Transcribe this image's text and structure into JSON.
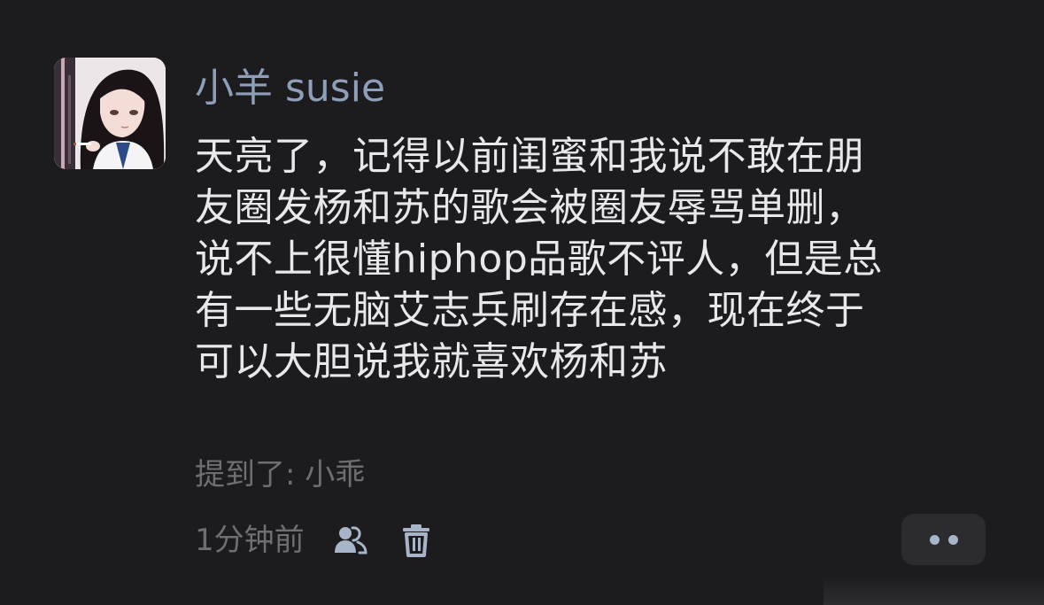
{
  "post": {
    "author_name": "小羊 susie",
    "content_lines": [
      "天亮了，记得以前闺蜜和我说不敢在朋",
      "友圈发杨和苏的歌会被圈友辱骂单删，",
      "说不上很懂hiphop品歌不评人，但是总",
      "有一些无脑艾志兵刷存在感，现在终于",
      "可以大胆说我就喜欢杨和苏"
    ],
    "mention_text": "提到了: 小乖",
    "timestamp": "1分钟前",
    "icons": {
      "visibility": "friends-icon",
      "delete": "trash-icon",
      "more": "more-dots-icon"
    },
    "colors": {
      "background": "#1c1c1e",
      "author": "#8f9fb9",
      "text": "#e8e8ea",
      "muted": "#6e6e73",
      "icon": "#a8b4c8"
    }
  }
}
